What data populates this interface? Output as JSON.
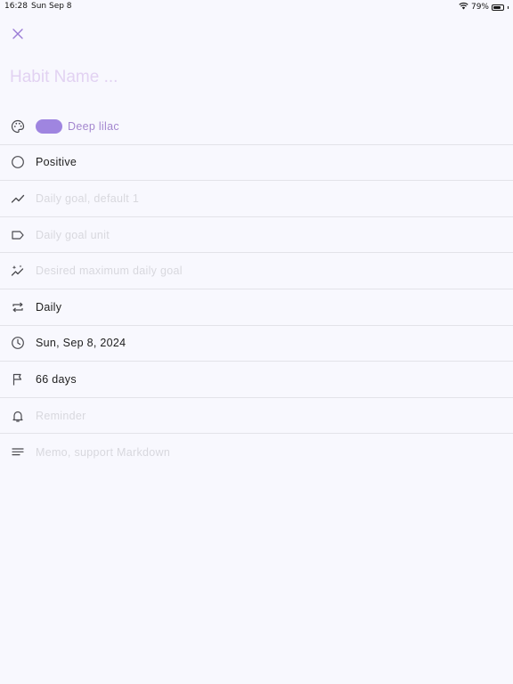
{
  "status_bar": {
    "time": "16:28",
    "date": "Sun Sep 8",
    "battery": "79%",
    "battery_level": 0.79
  },
  "form": {
    "habit_name_placeholder": "Habit Name ...",
    "color": {
      "name": "Deep lilac",
      "swatch": "#9f85e0",
      "text_color": "#a487cf"
    },
    "type": "Positive",
    "daily_goal_placeholder": "Daily goal, default 1",
    "daily_goal_unit_placeholder": "Daily goal unit",
    "max_daily_goal_placeholder": "Desired maximum daily goal",
    "frequency": "Daily",
    "start_date": "Sun, Sep 8, 2024",
    "target_days": "66 days",
    "reminder_placeholder": "Reminder",
    "memo_placeholder": "Memo, support Markdown"
  },
  "icons": {
    "close": "close-icon",
    "palette": "palette-icon",
    "circle": "circle-icon",
    "trend": "trend-icon",
    "label": "label-icon",
    "sparkle": "sparkle-trend-icon",
    "repeat": "repeat-icon",
    "clock": "clock-icon",
    "flag": "flag-icon",
    "bell": "bell-icon",
    "notes": "notes-icon"
  },
  "colors": {
    "accent": "#9a7bd6",
    "icon": "#4a4a4f",
    "divider": "#e3e3e9",
    "background": "#f8f8fe"
  }
}
